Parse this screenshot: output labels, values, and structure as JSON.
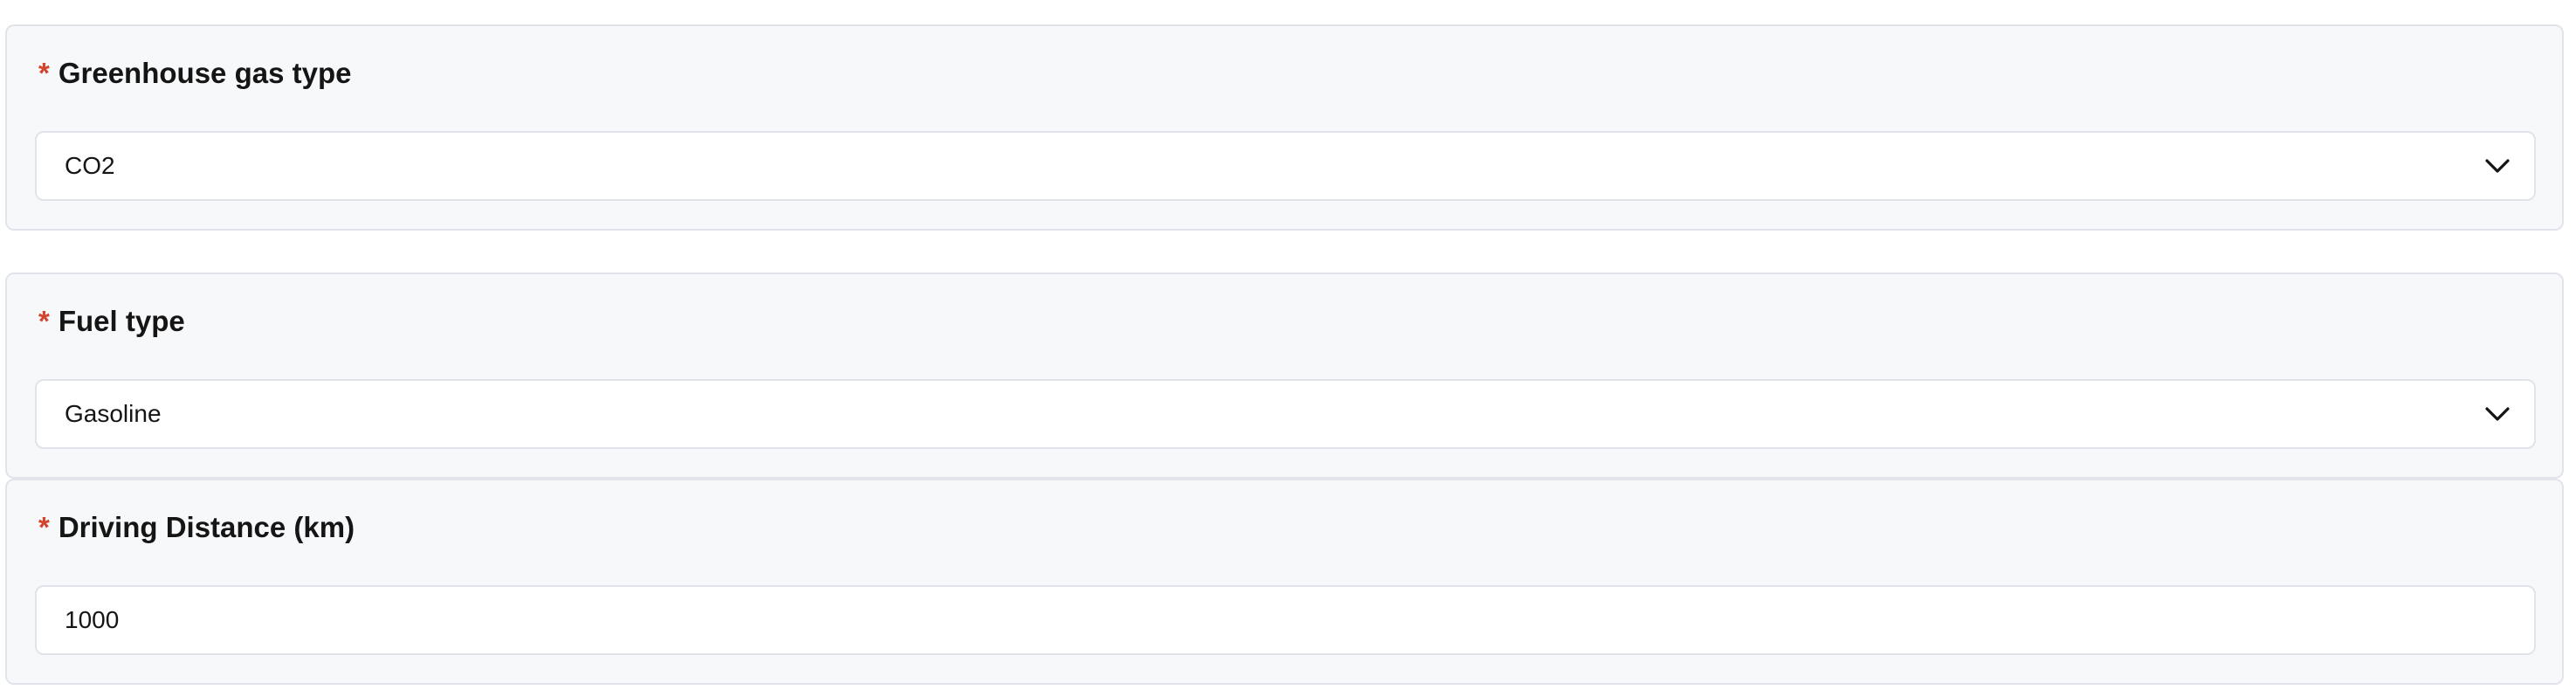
{
  "fields": [
    {
      "required_marker": "*",
      "label": "Greenhouse gas type",
      "value": "CO2",
      "control": "select",
      "icon": "chevron-down-icon"
    },
    {
      "required_marker": "*",
      "label": "Fuel type",
      "value": "Gasoline",
      "control": "select",
      "icon": "chevron-down-icon"
    },
    {
      "required_marker": "*",
      "label": "Driving Distance (km)",
      "value": "1000",
      "control": "text-input"
    }
  ],
  "colors": {
    "required_marker": "#d2452c",
    "panel_background": "#f7f8fa",
    "border": "#e1e4ea",
    "text": "#151515"
  }
}
